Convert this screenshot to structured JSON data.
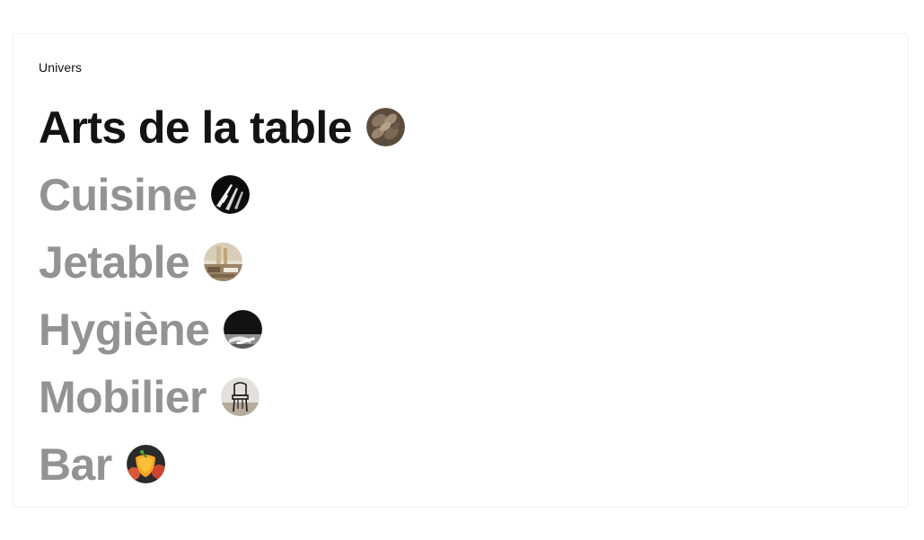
{
  "section": {
    "label": "Univers"
  },
  "universes": [
    {
      "label": "Arts de la table",
      "active": true,
      "thumb_icon": "plates-stack-image"
    },
    {
      "label": "Cuisine",
      "active": false,
      "thumb_icon": "knives-image"
    },
    {
      "label": "Jetable",
      "active": false,
      "thumb_icon": "disposables-image"
    },
    {
      "label": "Hygiène",
      "active": false,
      "thumb_icon": "cleaning-image"
    },
    {
      "label": "Mobilier",
      "active": false,
      "thumb_icon": "chair-image"
    },
    {
      "label": "Bar",
      "active": false,
      "thumb_icon": "cocktail-image"
    }
  ],
  "colors": {
    "active_text": "#131313",
    "inactive_text": "#939393",
    "card_border": "#efefef"
  }
}
